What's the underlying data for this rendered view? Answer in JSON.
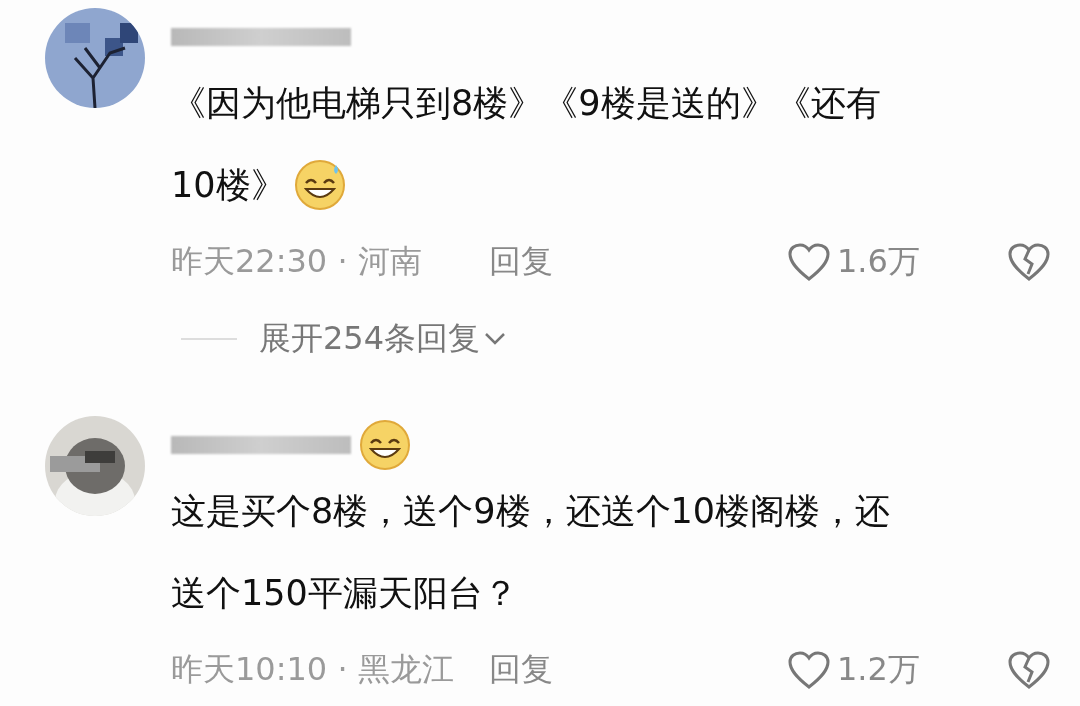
{
  "comments": [
    {
      "name_badge": false,
      "text_lines": [
        "《因为他电梯只到8楼》《9楼是送的》《还有",
        "10楼》"
      ],
      "emoji": true,
      "meta": "昨天22:30 · 河南",
      "reply": "回复",
      "likes": "1.6万",
      "expand": "展开254条回复"
    },
    {
      "name_badge": true,
      "text_lines": [
        "这是买个8楼，送个9楼，还送个10楼阁楼，还",
        "送个150平漏天阳台？"
      ],
      "emoji": false,
      "meta": "昨天10:10 · 黑龙江",
      "reply": "回复",
      "likes": "1.2万"
    }
  ]
}
